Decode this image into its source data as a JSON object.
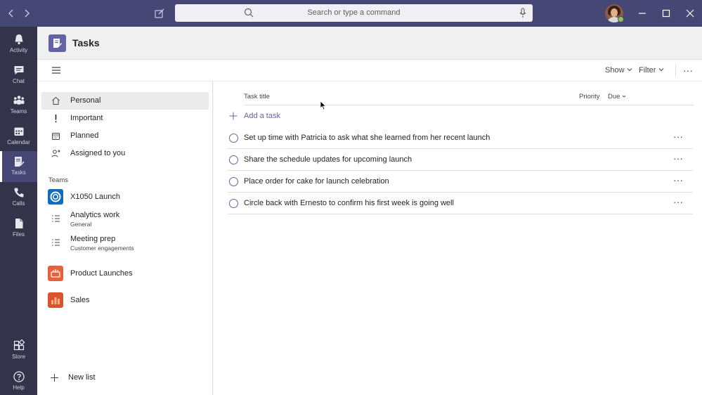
{
  "titlebar": {
    "search_placeholder": "Search or type a command",
    "back_icon": "chevron-left-icon",
    "forward_icon": "chevron-right-icon"
  },
  "rail": {
    "items": [
      {
        "label": "Activity",
        "icon": "bell-icon"
      },
      {
        "label": "Chat",
        "icon": "chat-icon"
      },
      {
        "label": "Teams",
        "icon": "teams-icon"
      },
      {
        "label": "Calendar",
        "icon": "calendar-icon"
      },
      {
        "label": "Tasks",
        "icon": "tasks-icon",
        "active": true
      },
      {
        "label": "Calls",
        "icon": "phone-icon"
      },
      {
        "label": "Files",
        "icon": "file-icon"
      }
    ],
    "bottom": [
      {
        "label": "Store",
        "icon": "store-icon"
      },
      {
        "label": "Help",
        "icon": "help-icon"
      }
    ]
  },
  "app": {
    "title": "Tasks"
  },
  "toolbar": {
    "show_label": "Show",
    "filter_label": "Filter",
    "more_label": "···"
  },
  "nav": {
    "personal": [
      {
        "label": "Personal",
        "icon": "home-icon",
        "selected": true
      },
      {
        "label": "Important",
        "icon": "exclamation-icon"
      },
      {
        "label": "Planned",
        "icon": "calendar-icon"
      },
      {
        "label": "Assigned to you",
        "icon": "person-assigned-icon"
      }
    ],
    "teams_heading": "Teams",
    "teams": [
      {
        "label": "X1050 Launch",
        "icon": "x1050-team-icon",
        "color": "#0f6cbd"
      },
      {
        "label": "Analytics work",
        "sub": "General",
        "icon": "list-icon"
      },
      {
        "label": "Meeting prep",
        "sub": "Customer engagements",
        "icon": "list-icon"
      },
      {
        "label": "Product Launches",
        "icon": "product-launches-icon",
        "color": "#e8603c"
      },
      {
        "label": "Sales",
        "icon": "sales-icon",
        "color": "#d9532c"
      }
    ],
    "new_list": "New list"
  },
  "main": {
    "col_title": "Task title",
    "col_priority": "Priority",
    "col_due": "Due",
    "add_task": "Add a task",
    "tasks": [
      {
        "title": "Set up time with Patricia to ask what she learned from her recent launch"
      },
      {
        "title": "Share the schedule updates for upcoming launch"
      },
      {
        "title": "Place order for cake for launch celebration"
      },
      {
        "title": "Circle back with Ernesto to confirm his first week is going well"
      }
    ],
    "row_more": "···"
  },
  "colors": {
    "titlebar": "#464775",
    "rail": "#33344a",
    "accent": "#6264a7",
    "presence": "#92c353"
  }
}
